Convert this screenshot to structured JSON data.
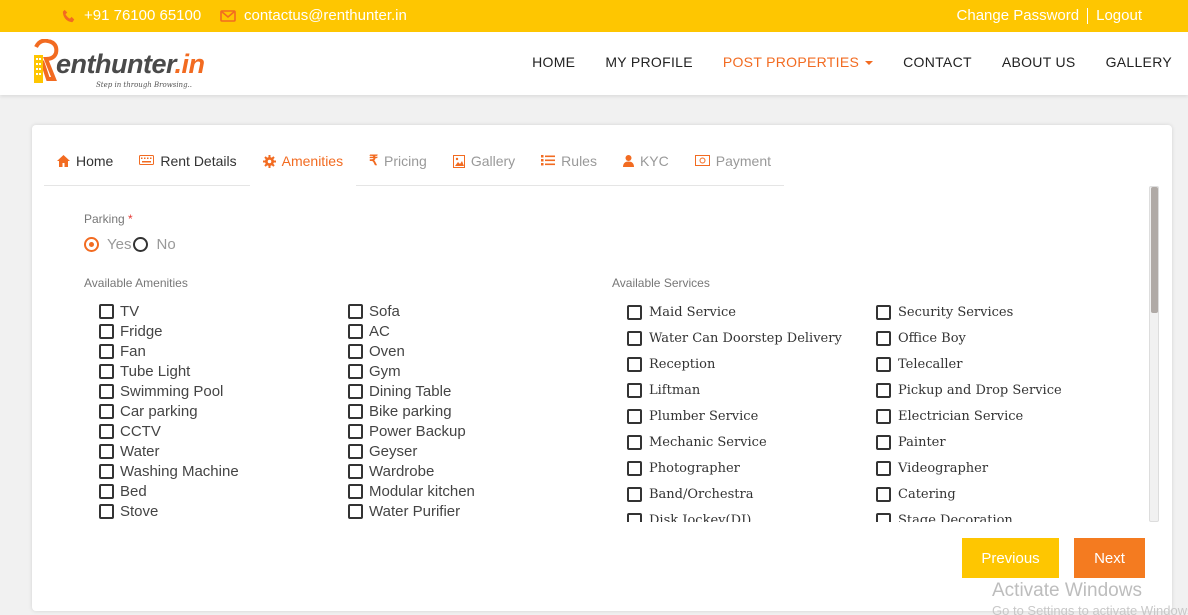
{
  "topbar": {
    "phone": "+91 76100 65100",
    "email": "contactus@renthunter.in",
    "change_password": "Change Password",
    "logout": "Logout"
  },
  "brand": {
    "logo_text": "enthunter",
    "logo_suffix": ".in",
    "tagline": "Step in through Browsing..",
    "accent_color": "#f26b21",
    "yellow_color": "#fec601"
  },
  "nav": {
    "home": "HOME",
    "profile": "MY PROFILE",
    "post": "POST PROPERTIES",
    "contact": "CONTACT",
    "about": "ABOUT US",
    "gallery": "GALLERY"
  },
  "tabs": {
    "home": "Home",
    "rent": "Rent Details",
    "amenities": "Amenities",
    "pricing": "Pricing",
    "gallery": "Gallery",
    "rules": "Rules",
    "kyc": "KYC",
    "payment": "Payment"
  },
  "form": {
    "parking_label": "Parking",
    "required_mark": "*",
    "yes": "Yes",
    "no": "No",
    "amenities_label": "Available Amenities",
    "services_label": "Available Services"
  },
  "amenities_col1": [
    "TV",
    "Fridge",
    "Fan",
    "Tube Light",
    "Swimming Pool",
    "Car parking",
    "CCTV",
    "Water",
    "Washing Machine",
    "Bed",
    "Stove"
  ],
  "amenities_col2": [
    "Sofa",
    "AC",
    "Oven",
    "Gym",
    "Dining Table",
    "Bike parking",
    "Power Backup",
    "Geyser",
    "Wardrobe",
    "Modular kitchen",
    "Water Purifier"
  ],
  "services_col1": [
    "Maid Service",
    "Water Can Doorstep Delivery",
    "Reception",
    "Liftman",
    "Plumber Service",
    "Mechanic Service",
    "Photographer",
    "Band/Orchestra",
    "Disk Jockey(DJ)"
  ],
  "services_col2": [
    "Security Services",
    "Office Boy",
    "Telecaller",
    "Pickup and Drop Service",
    "Electrician Service",
    "Painter",
    "Videographer",
    "Catering",
    "Stage Decoration"
  ],
  "buttons": {
    "previous": "Previous",
    "next": "Next"
  },
  "watermark": {
    "line1": "Activate Windows",
    "line2": "Go to Settings to activate Windows."
  }
}
